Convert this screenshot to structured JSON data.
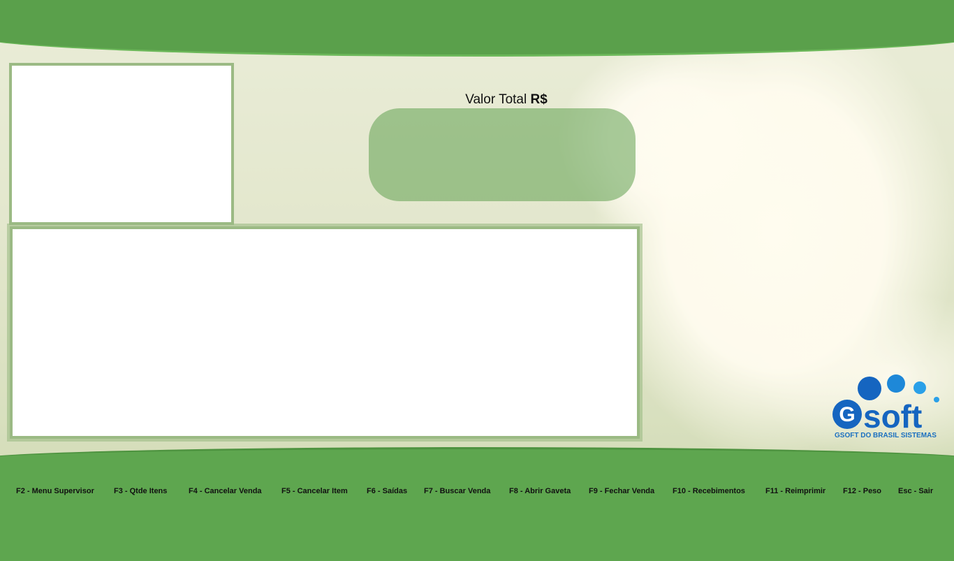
{
  "total": {
    "label": "Valor Total",
    "currency": "R$",
    "value": ""
  },
  "shortcuts": [
    {
      "label": "F2 - Menu Supervisor"
    },
    {
      "label": "F3 - Qtde Itens"
    },
    {
      "label": "F4 - Cancelar Venda"
    },
    {
      "label": "F5 - Cancelar Item"
    },
    {
      "label": "F6 - Saídas"
    },
    {
      "label": "F7 - Buscar Venda"
    },
    {
      "label": "F8 - Abrir Gaveta"
    },
    {
      "label": "F9 - Fechar Venda"
    },
    {
      "label": "F10 - Recebimentos"
    },
    {
      "label": "F11 - Reimprimir"
    },
    {
      "label": "F12 - Peso"
    },
    {
      "label": "Esc - Sair"
    }
  ],
  "logo": {
    "wordmark": "Gsoft",
    "caption": "GSOFT DO BRASIL SISTEMAS",
    "icon": "gsoft-logo-icon"
  },
  "colors": {
    "brand_green": "#5aa04b",
    "brand_blue": "#1a6fc0",
    "panel_border": "#9bba84"
  },
  "background": {
    "icon": "puppy-and-kitten-photo"
  }
}
